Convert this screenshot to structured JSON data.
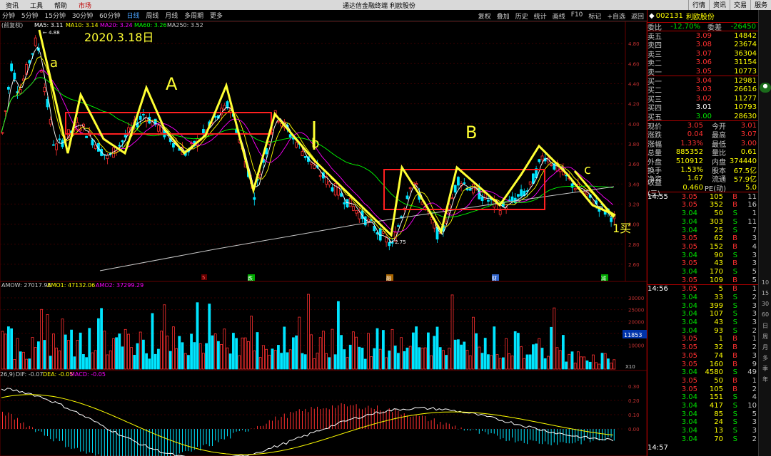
{
  "topbar": {
    "menu": [
      "资讯",
      "工具",
      "帮助",
      "市场"
    ],
    "title": "通达信金融终端 利欧股份",
    "right": [
      "行情",
      "资讯",
      "交易",
      "服务"
    ]
  },
  "toolbar": {
    "periods": [
      "分钟",
      "5分钟",
      "15分钟",
      "30分钟",
      "60分钟",
      "日线",
      "周线",
      "月线",
      "多周期",
      "更多"
    ],
    "selected_period": "日线",
    "tools": [
      "复权",
      "叠加",
      "历史",
      "统计",
      "画线",
      "F10",
      "标记",
      "+自选",
      "返回"
    ]
  },
  "chart": {
    "ma_header_prefix": "(前复权)",
    "ma5": "MA5: 3.11",
    "ma10": "MA10: 3.14",
    "ma20": "MA20: 3.24",
    "ma60": "MA60: 3.26",
    "ma250": "MA250: 3.52",
    "colors": {
      "ma5": "#ffffff",
      "ma10": "#ffff00",
      "ma20": "#ff00ff",
      "ma60": "#00ff00",
      "ma250": "#c8c8c8",
      "up": "#ff3030",
      "down": "#00e5ff",
      "annotation": "#ffff33",
      "box": "#ff2020"
    },
    "date_annotation": "2020.3.18日",
    "high_label": "4.88",
    "low_label": "2.75",
    "wave_labels": [
      "a",
      "A",
      "b",
      "B",
      "c"
    ],
    "buy_label": "1买",
    "price_ticks": [
      "4.80",
      "4.60",
      "4.40",
      "4.20",
      "4.00",
      "3.80",
      "3.60",
      "3.40",
      "3.20",
      "3.00",
      "2.80",
      "2.60"
    ],
    "markers": [
      "5",
      "跌",
      "融",
      "财",
      "减"
    ]
  },
  "amo": {
    "amow": "AMOW: 27017.98",
    "amo1": "AMO1: 47132.06",
    "amo2": "AMO2: 37299.29",
    "ticks": [
      "30000",
      "25000",
      "20000",
      "15000",
      "10000"
    ],
    "current": "11853",
    "unit": "X10"
  },
  "macd": {
    "params": "26,9)",
    "dif": "DIF: -0.07",
    "dea": "DEA: -0.05",
    "macd": "MACD: -0.05",
    "ticks": [
      "0.30",
      "0.20",
      "0.10",
      "0.00"
    ]
  },
  "quote": {
    "code": "002131",
    "name": "利欧股份",
    "wei_bi_label": "委比",
    "wei_bi": "-12.70%",
    "wei_cha_label": "委差",
    "wei_cha": "-26450",
    "asks": [
      {
        "label": "卖五",
        "price": "3.09",
        "vol": "14842"
      },
      {
        "label": "卖四",
        "price": "3.08",
        "vol": "23674"
      },
      {
        "label": "卖三",
        "price": "3.07",
        "vol": "36304"
      },
      {
        "label": "卖二",
        "price": "3.06",
        "vol": "31154"
      },
      {
        "label": "卖一",
        "price": "3.05",
        "vol": "10773"
      }
    ],
    "bids": [
      {
        "label": "买一",
        "price": "3.04",
        "vol": "12981"
      },
      {
        "label": "买二",
        "price": "3.03",
        "vol": "26616"
      },
      {
        "label": "买三",
        "price": "3.02",
        "vol": "11277"
      },
      {
        "label": "买四",
        "price": "3.01",
        "vol": "10793"
      },
      {
        "label": "买五",
        "price": "3.00",
        "vol": "28630"
      }
    ],
    "stats": [
      {
        "l1": "现价",
        "v1": "3.05",
        "l2": "今开",
        "v2": "3.01"
      },
      {
        "l1": "涨跌",
        "v1": "0.04",
        "l2": "最高",
        "v2": "3.07"
      },
      {
        "l1": "涨幅",
        "v1": "1.33%",
        "l2": "最低",
        "v2": "3.00"
      },
      {
        "l1": "总量",
        "v1": "885352",
        "l2": "量比",
        "v2": "0.61"
      },
      {
        "l1": "外盘",
        "v1": "510912",
        "l2": "内盘",
        "v2": "374440"
      },
      {
        "l1": "换手",
        "v1": "1.53%",
        "l2": "股本",
        "v2": "67.5亿"
      },
      {
        "l1": "净资",
        "v1": "1.67",
        "l2": "流通",
        "v2": "57.9亿"
      },
      {
        "l1": "收益(三)",
        "v1": "0.460",
        "l2": "PE(动)",
        "v2": "5.0"
      }
    ]
  },
  "ticks_1455": {
    "time": "14:55",
    "rows": [
      [
        "3.05",
        "105",
        "B",
        "11"
      ],
      [
        "3.05",
        "352",
        "B",
        "16"
      ],
      [
        "3.04",
        "50",
        "S",
        "1"
      ],
      [
        "3.04",
        "303",
        "S",
        "11"
      ],
      [
        "3.04",
        "25",
        "S",
        "7"
      ],
      [
        "3.05",
        "62",
        "B",
        "3"
      ],
      [
        "3.05",
        "152",
        "B",
        "4"
      ],
      [
        "3.04",
        "90",
        "S",
        "3"
      ],
      [
        "3.05",
        "43",
        "B",
        "3"
      ],
      [
        "3.04",
        "170",
        "S",
        "5"
      ],
      [
        "3.05",
        "109",
        "B",
        "5"
      ]
    ]
  },
  "ticks_1456": {
    "time": "14:56",
    "rows": [
      [
        "3.05",
        "5",
        "B",
        "1"
      ],
      [
        "3.04",
        "33",
        "S",
        "2"
      ],
      [
        "3.04",
        "399",
        "S",
        "3"
      ],
      [
        "3.04",
        "107",
        "S",
        "3"
      ],
      [
        "3.04",
        "43",
        "S",
        "3"
      ],
      [
        "3.04",
        "93",
        "S",
        "2"
      ],
      [
        "3.05",
        "1",
        "B",
        "1"
      ],
      [
        "3.05",
        "32",
        "B",
        "2"
      ],
      [
        "3.05",
        "74",
        "B",
        "3"
      ],
      [
        "3.05",
        "160",
        "B",
        "9"
      ],
      [
        "3.04",
        "4580",
        "S",
        "49"
      ],
      [
        "3.05",
        "50",
        "B",
        "1"
      ],
      [
        "3.05",
        "105",
        "B",
        "2"
      ],
      [
        "3.04",
        "151",
        "S",
        "4"
      ],
      [
        "3.04",
        "417",
        "S",
        "10"
      ],
      [
        "3.04",
        "85",
        "S",
        "5"
      ],
      [
        "3.04",
        "24",
        "S",
        "3"
      ],
      [
        "3.04",
        "13",
        "S",
        "3"
      ],
      [
        "3.04",
        "70",
        "S",
        "2"
      ]
    ]
  },
  "ticks_1457": {
    "time": "14:57"
  },
  "side": [
    "10",
    "15",
    "30",
    "60",
    "日",
    "周",
    "月",
    "多",
    "季",
    "年"
  ]
}
